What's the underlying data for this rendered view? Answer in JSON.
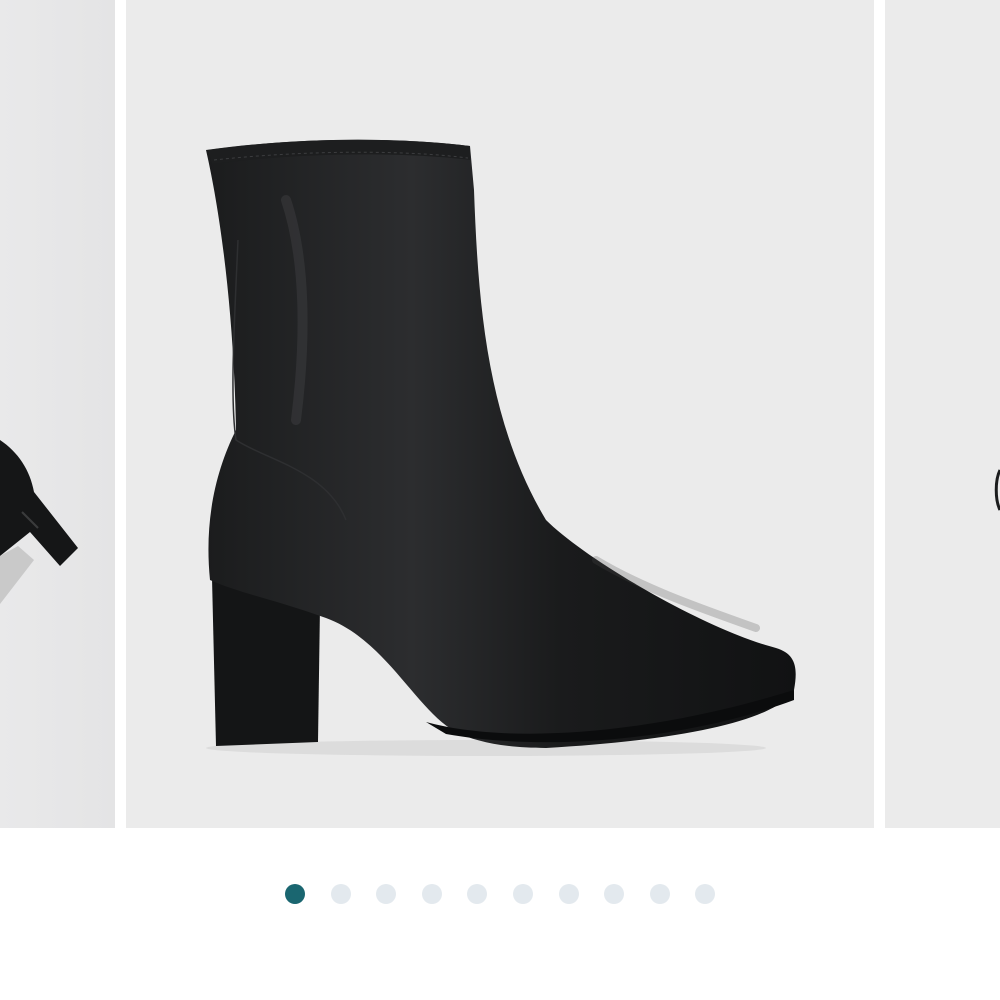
{
  "gallery": {
    "slide_count": 10,
    "active_index": 0,
    "zoom_icon": "magnifier-icon",
    "colors": {
      "image_background": "#ebebeb",
      "boot": "#151617",
      "dot_active": "#1a6670",
      "dot_inactive": "#e3e9ee"
    }
  }
}
